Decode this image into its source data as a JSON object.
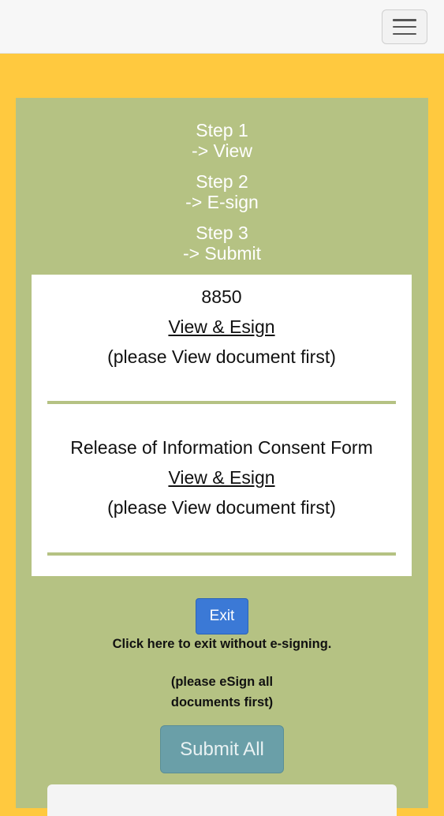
{
  "header": {
    "menu_icon": "hamburger-icon"
  },
  "steps": [
    {
      "label": "Step 1",
      "action": "-> View"
    },
    {
      "label": "Step 2",
      "action": "-> E-sign"
    },
    {
      "label": "Step 3",
      "action": "-> Submit"
    }
  ],
  "documents": [
    {
      "title": "8850",
      "link_label": "View & Esign",
      "note": "(please View document first)"
    },
    {
      "title": "Release of Information Consent Form",
      "link_label": "View & Esign",
      "note": "(please View document first)"
    }
  ],
  "actions": {
    "exit_label": "Exit",
    "exit_text": "Click here to exit without e-signing.",
    "esign_note_line1": "(please eSign all",
    "esign_note_line2": "documents first)",
    "submit_label": "Submit All"
  },
  "colors": {
    "background": "#ffc93f",
    "panel": "#b5c283",
    "exit_button": "#3b79d6",
    "submit_button": "#6a9fa8"
  }
}
